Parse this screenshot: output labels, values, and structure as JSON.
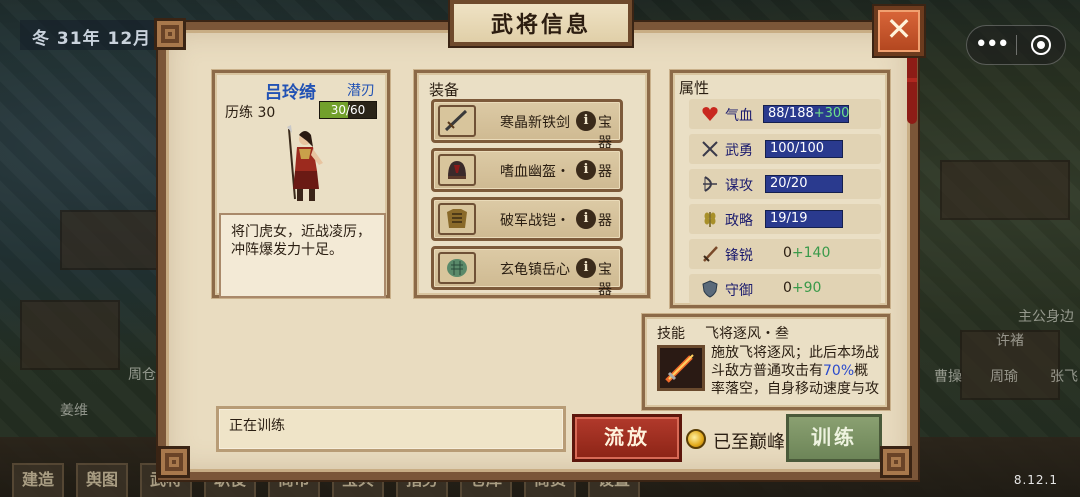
{
  "window": {
    "title": "武将信息",
    "close_label": "✕"
  },
  "background": {
    "date": "冬 31年 12月",
    "labels": [
      "周仓",
      "姜维",
      "许褚",
      "曹操",
      "周瑜",
      "张飞",
      "主公身边"
    ],
    "tabs": [
      "建造",
      "舆图",
      "武将",
      "职役",
      "商市",
      "宝兵",
      "指务",
      "仓库",
      "商贸",
      "设置"
    ],
    "version": "8.12.1"
  },
  "general": {
    "name": "吕玲绮",
    "class": "潜刃",
    "exp_label": "历练 30",
    "exp_current": 30,
    "exp_max": 60,
    "exp_text": "30/60",
    "bio": "将门虎女，近战凌厉，冲阵爆发力十足。"
  },
  "equipment": {
    "title": "装备",
    "items": [
      {
        "name": "寒晶新铁剑",
        "tag": "宝器",
        "icon": "sword-icon"
      },
      {
        "name": "嗜血幽盔・",
        "tag": "器",
        "icon": "helmet-icon"
      },
      {
        "name": "破军战铠・",
        "tag": "器",
        "icon": "armor-icon"
      },
      {
        "name": "玄龟镇岳心",
        "tag": "宝器",
        "icon": "jade-icon"
      }
    ]
  },
  "attributes": {
    "title": "属性",
    "rows": [
      {
        "label": "气血",
        "value": "88/188",
        "bonus": "+300",
        "icon": "heart-icon",
        "style": "bar"
      },
      {
        "label": "武勇",
        "value": "100/100",
        "bonus": "",
        "icon": "crossed-swords-icon",
        "style": "bar"
      },
      {
        "label": "谋攻",
        "value": "20/20",
        "bonus": "",
        "icon": "bow-icon",
        "style": "bar"
      },
      {
        "label": "政略",
        "value": "19/19",
        "bonus": "",
        "icon": "wheat-icon",
        "style": "bar"
      },
      {
        "label": "锋锐",
        "value": "0",
        "bonus": "+140",
        "icon": "blade-icon",
        "style": "plain"
      },
      {
        "label": "守御",
        "value": "0",
        "bonus": "+90",
        "icon": "shield-icon",
        "style": "plain"
      }
    ]
  },
  "skill": {
    "head": "技能",
    "name": "飞将逐风・叁",
    "desc_before": "施放飞将逐风；此后本场战斗敌方普通攻击有",
    "desc_highlight": "70%",
    "desc_after": "概率落空，自身移动速度与攻击速度各提",
    "icon": "flaming-sword-icon"
  },
  "footer": {
    "status": "正在训练",
    "release_label": "流放",
    "peak_label": "已至巅峰",
    "train_label": "训练"
  },
  "capsule": {
    "more_label": "•••"
  },
  "colors": {
    "frame": "#7b5638",
    "parchment": "#e9dcc0",
    "name_blue": "#2252b4",
    "attr_bar": "#2a3a8e",
    "bonus_green": "#3a9a4a",
    "release_red": "#b23a2c",
    "train_green": "#7a9262"
  }
}
